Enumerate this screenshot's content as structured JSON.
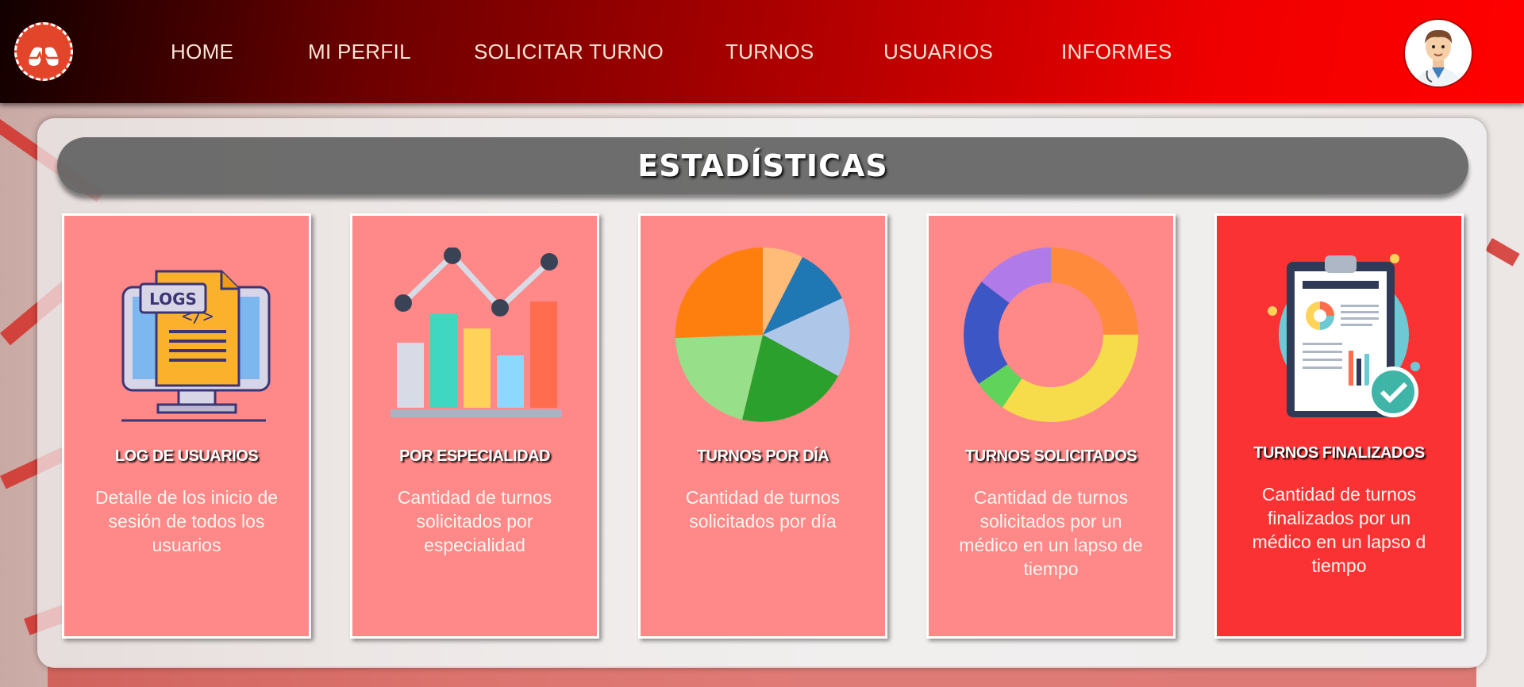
{
  "nav": {
    "items": [
      "HOME",
      "MI PERFIL",
      "SOLICITAR TURNO",
      "TURNOS",
      "USUARIOS",
      "INFORMES"
    ],
    "logo_icon": "lungs-heartbeat-icon",
    "avatar_icon": "doctor-avatar-icon"
  },
  "page": {
    "title": "ESTADÍSTICAS"
  },
  "cards": [
    {
      "title": "LOG DE USUARIOS",
      "description": "Detalle de los inicio de sesión de todos los usuarios",
      "icon": "logs-monitor-icon",
      "active": false,
      "logs_label": "LOGS"
    },
    {
      "title": "POR ESPECIALIDAD",
      "description": "Cantidad de turnos solicitados por especialidad",
      "icon": "bar-line-chart-icon",
      "active": false
    },
    {
      "title": "TURNOS POR DÍA",
      "description": "Cantidad de turnos solicitados por día",
      "icon": "pie-chart-icon",
      "active": false
    },
    {
      "title": "TURNOS SOLICITADOS",
      "description": "Cantidad de turnos solicitados por un médico en un lapso de tiempo",
      "icon": "donut-chart-icon",
      "active": false
    },
    {
      "title": "TURNOS FINALIZADOS",
      "description": "Cantidad de turnos finalizados por un médico en un lapso d tiempo",
      "icon": "clipboard-report-icon",
      "active": true
    }
  ],
  "colors": {
    "card": "#ff8888",
    "card_active": "#fb3234",
    "nav_start": "#120000",
    "nav_end": "#ff0000"
  }
}
